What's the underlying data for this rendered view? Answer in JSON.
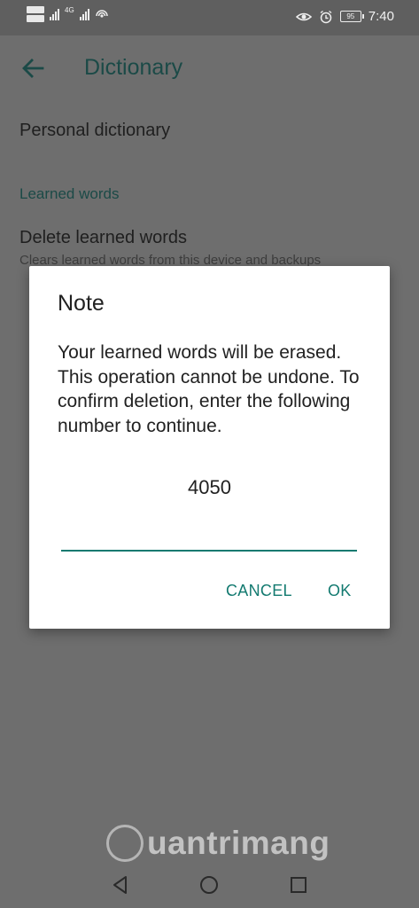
{
  "status_bar": {
    "time": "7:40",
    "battery": "95",
    "network": "4G",
    "icons": [
      "sim-icon",
      "signal-icon",
      "hotspot-icon",
      "eye-icon",
      "alarm-icon",
      "battery-icon"
    ]
  },
  "app_bar": {
    "title": "Dictionary",
    "back_icon": "arrow-back-icon"
  },
  "settings": {
    "personal_dictionary": "Personal dictionary",
    "section_header": "Learned words",
    "delete_title": "Delete learned words",
    "delete_summary": "Clears learned words from this device and backups"
  },
  "dialog": {
    "title": "Note",
    "message": "Your learned words will be erased. This operation cannot be undone. To confirm deletion, enter the following number to continue.",
    "code": "4050",
    "input_value": "",
    "cancel_label": "CANCEL",
    "ok_label": "OK"
  },
  "watermark": {
    "text": "uantrimang"
  },
  "nav_bar": {
    "icons": [
      "back-triangle-icon",
      "home-circle-icon",
      "recents-square-icon"
    ]
  },
  "colors": {
    "accent": "#137a70",
    "scrim_bg": "#6e6e6e",
    "dialog_bg": "#ffffff"
  }
}
